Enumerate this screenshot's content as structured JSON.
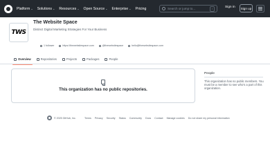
{
  "nav": {
    "items": [
      {
        "label": "Platform"
      },
      {
        "label": "Solutions"
      },
      {
        "label": "Resources"
      },
      {
        "label": "Open Source"
      },
      {
        "label": "Enterprise"
      },
      {
        "label": "Pricing"
      }
    ],
    "search_placeholder": "Search or jump to...",
    "search_key": "/",
    "sign_in": "Sign in",
    "sign_up": "Sign up"
  },
  "org": {
    "logo_text": "TWS",
    "name": "The Website Space",
    "description": "Distinct Digital Marketing Strategies For Your Business",
    "followers": "1 follower",
    "website": "https://thewebsitespace.com",
    "twitter": "@thewebsitespace",
    "email": "hello@thewebsitespace.com"
  },
  "tabs": [
    {
      "label": "Overview",
      "icon": "book-icon",
      "active": true
    },
    {
      "label": "Repositories",
      "icon": "repo-icon",
      "active": false
    },
    {
      "label": "Projects",
      "icon": "table-icon",
      "active": false
    },
    {
      "label": "Packages",
      "icon": "package-icon",
      "active": false
    },
    {
      "label": "People",
      "icon": "person-icon",
      "active": false
    }
  ],
  "repos": {
    "empty_message": "This organization has no public repositories."
  },
  "people": {
    "title": "People",
    "description": "This organization has no public members. You must be a member to see who's a part of this organization."
  },
  "footer": {
    "copyright": "© 2025 GitHub, Inc.",
    "links": [
      {
        "label": "Terms"
      },
      {
        "label": "Privacy"
      },
      {
        "label": "Security"
      },
      {
        "label": "Status"
      },
      {
        "label": "Community"
      },
      {
        "label": "Docs"
      },
      {
        "label": "Contact"
      },
      {
        "label": "Manage cookies"
      },
      {
        "label": "Do not share my personal information"
      }
    ]
  }
}
